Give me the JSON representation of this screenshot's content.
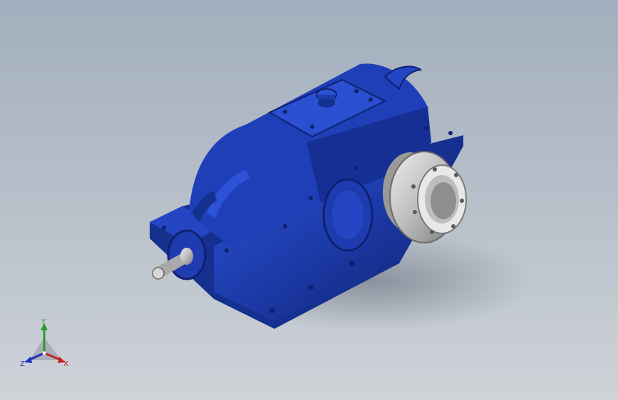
{
  "viewport": {
    "background_top": "#a3afbe",
    "background_bottom": "#cfd3d8"
  },
  "model": {
    "icon": "gear-reducer-3d-model",
    "body_color": "#1c3aa8",
    "body_dark": "#0f2170",
    "metal_color": "#c9c9c9"
  },
  "triad": {
    "icon": "coordinate-triad-icon",
    "x_label": "X",
    "y_label": "Y",
    "z_label": "Z",
    "x_color": "#c52020",
    "y_color": "#2a9a2a",
    "z_color": "#2030c0"
  }
}
